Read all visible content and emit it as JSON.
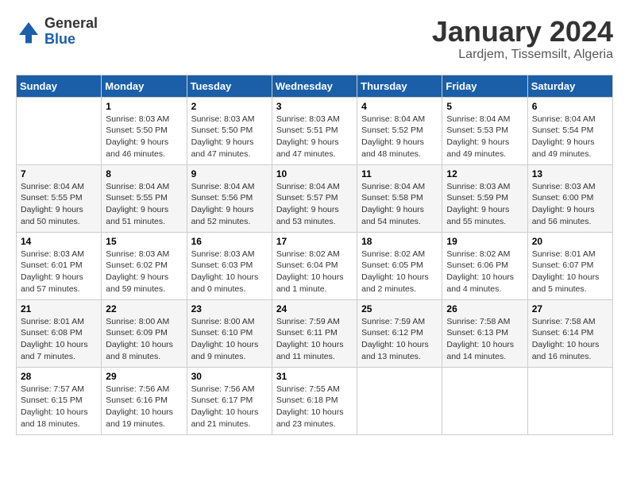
{
  "header": {
    "logo_general": "General",
    "logo_blue": "Blue",
    "month_year": "January 2024",
    "location": "Lardjem, Tissemsilt, Algeria"
  },
  "weekdays": [
    "Sunday",
    "Monday",
    "Tuesday",
    "Wednesday",
    "Thursday",
    "Friday",
    "Saturday"
  ],
  "weeks": [
    [
      {
        "day": "",
        "sunrise": "",
        "sunset": "",
        "daylight": ""
      },
      {
        "day": "1",
        "sunrise": "Sunrise: 8:03 AM",
        "sunset": "Sunset: 5:50 PM",
        "daylight": "Daylight: 9 hours and 46 minutes."
      },
      {
        "day": "2",
        "sunrise": "Sunrise: 8:03 AM",
        "sunset": "Sunset: 5:50 PM",
        "daylight": "Daylight: 9 hours and 47 minutes."
      },
      {
        "day": "3",
        "sunrise": "Sunrise: 8:03 AM",
        "sunset": "Sunset: 5:51 PM",
        "daylight": "Daylight: 9 hours and 47 minutes."
      },
      {
        "day": "4",
        "sunrise": "Sunrise: 8:04 AM",
        "sunset": "Sunset: 5:52 PM",
        "daylight": "Daylight: 9 hours and 48 minutes."
      },
      {
        "day": "5",
        "sunrise": "Sunrise: 8:04 AM",
        "sunset": "Sunset: 5:53 PM",
        "daylight": "Daylight: 9 hours and 49 minutes."
      },
      {
        "day": "6",
        "sunrise": "Sunrise: 8:04 AM",
        "sunset": "Sunset: 5:54 PM",
        "daylight": "Daylight: 9 hours and 49 minutes."
      }
    ],
    [
      {
        "day": "7",
        "sunrise": "Sunrise: 8:04 AM",
        "sunset": "Sunset: 5:55 PM",
        "daylight": "Daylight: 9 hours and 50 minutes."
      },
      {
        "day": "8",
        "sunrise": "Sunrise: 8:04 AM",
        "sunset": "Sunset: 5:55 PM",
        "daylight": "Daylight: 9 hours and 51 minutes."
      },
      {
        "day": "9",
        "sunrise": "Sunrise: 8:04 AM",
        "sunset": "Sunset: 5:56 PM",
        "daylight": "Daylight: 9 hours and 52 minutes."
      },
      {
        "day": "10",
        "sunrise": "Sunrise: 8:04 AM",
        "sunset": "Sunset: 5:57 PM",
        "daylight": "Daylight: 9 hours and 53 minutes."
      },
      {
        "day": "11",
        "sunrise": "Sunrise: 8:04 AM",
        "sunset": "Sunset: 5:58 PM",
        "daylight": "Daylight: 9 hours and 54 minutes."
      },
      {
        "day": "12",
        "sunrise": "Sunrise: 8:03 AM",
        "sunset": "Sunset: 5:59 PM",
        "daylight": "Daylight: 9 hours and 55 minutes."
      },
      {
        "day": "13",
        "sunrise": "Sunrise: 8:03 AM",
        "sunset": "Sunset: 6:00 PM",
        "daylight": "Daylight: 9 hours and 56 minutes."
      }
    ],
    [
      {
        "day": "14",
        "sunrise": "Sunrise: 8:03 AM",
        "sunset": "Sunset: 6:01 PM",
        "daylight": "Daylight: 9 hours and 57 minutes."
      },
      {
        "day": "15",
        "sunrise": "Sunrise: 8:03 AM",
        "sunset": "Sunset: 6:02 PM",
        "daylight": "Daylight: 9 hours and 59 minutes."
      },
      {
        "day": "16",
        "sunrise": "Sunrise: 8:03 AM",
        "sunset": "Sunset: 6:03 PM",
        "daylight": "Daylight: 10 hours and 0 minutes."
      },
      {
        "day": "17",
        "sunrise": "Sunrise: 8:02 AM",
        "sunset": "Sunset: 6:04 PM",
        "daylight": "Daylight: 10 hours and 1 minute."
      },
      {
        "day": "18",
        "sunrise": "Sunrise: 8:02 AM",
        "sunset": "Sunset: 6:05 PM",
        "daylight": "Daylight: 10 hours and 2 minutes."
      },
      {
        "day": "19",
        "sunrise": "Sunrise: 8:02 AM",
        "sunset": "Sunset: 6:06 PM",
        "daylight": "Daylight: 10 hours and 4 minutes."
      },
      {
        "day": "20",
        "sunrise": "Sunrise: 8:01 AM",
        "sunset": "Sunset: 6:07 PM",
        "daylight": "Daylight: 10 hours and 5 minutes."
      }
    ],
    [
      {
        "day": "21",
        "sunrise": "Sunrise: 8:01 AM",
        "sunset": "Sunset: 6:08 PM",
        "daylight": "Daylight: 10 hours and 7 minutes."
      },
      {
        "day": "22",
        "sunrise": "Sunrise: 8:00 AM",
        "sunset": "Sunset: 6:09 PM",
        "daylight": "Daylight: 10 hours and 8 minutes."
      },
      {
        "day": "23",
        "sunrise": "Sunrise: 8:00 AM",
        "sunset": "Sunset: 6:10 PM",
        "daylight": "Daylight: 10 hours and 9 minutes."
      },
      {
        "day": "24",
        "sunrise": "Sunrise: 7:59 AM",
        "sunset": "Sunset: 6:11 PM",
        "daylight": "Daylight: 10 hours and 11 minutes."
      },
      {
        "day": "25",
        "sunrise": "Sunrise: 7:59 AM",
        "sunset": "Sunset: 6:12 PM",
        "daylight": "Daylight: 10 hours and 13 minutes."
      },
      {
        "day": "26",
        "sunrise": "Sunrise: 7:58 AM",
        "sunset": "Sunset: 6:13 PM",
        "daylight": "Daylight: 10 hours and 14 minutes."
      },
      {
        "day": "27",
        "sunrise": "Sunrise: 7:58 AM",
        "sunset": "Sunset: 6:14 PM",
        "daylight": "Daylight: 10 hours and 16 minutes."
      }
    ],
    [
      {
        "day": "28",
        "sunrise": "Sunrise: 7:57 AM",
        "sunset": "Sunset: 6:15 PM",
        "daylight": "Daylight: 10 hours and 18 minutes."
      },
      {
        "day": "29",
        "sunrise": "Sunrise: 7:56 AM",
        "sunset": "Sunset: 6:16 PM",
        "daylight": "Daylight: 10 hours and 19 minutes."
      },
      {
        "day": "30",
        "sunrise": "Sunrise: 7:56 AM",
        "sunset": "Sunset: 6:17 PM",
        "daylight": "Daylight: 10 hours and 21 minutes."
      },
      {
        "day": "31",
        "sunrise": "Sunrise: 7:55 AM",
        "sunset": "Sunset: 6:18 PM",
        "daylight": "Daylight: 10 hours and 23 minutes."
      },
      {
        "day": "",
        "sunrise": "",
        "sunset": "",
        "daylight": ""
      },
      {
        "day": "",
        "sunrise": "",
        "sunset": "",
        "daylight": ""
      },
      {
        "day": "",
        "sunrise": "",
        "sunset": "",
        "daylight": ""
      }
    ]
  ]
}
